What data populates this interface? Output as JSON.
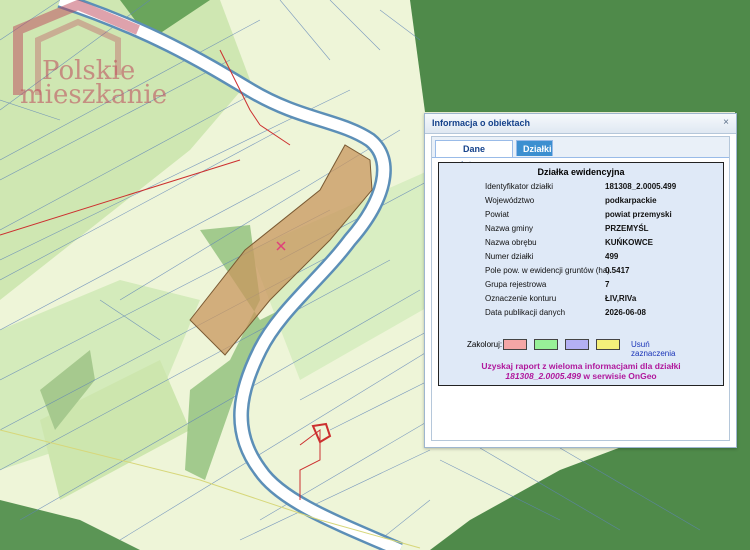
{
  "watermark": {
    "line1": "Polskie",
    "line2": "mieszkanie"
  },
  "panel": {
    "title": "Informacja o obiektach",
    "close": "×",
    "tabs": {
      "basic": "Dane podstawowe",
      "plots": "Działki"
    },
    "section_title": "Działka ewidencyjna",
    "attributes": [
      {
        "label": "Identyfikator działki",
        "value": "181308_2.0005.499"
      },
      {
        "label": "Województwo",
        "value": "podkarpackie"
      },
      {
        "label": "Powiat",
        "value": "powiat przemyski"
      },
      {
        "label": "Nazwa gminy",
        "value": "PRZEMYŚL"
      },
      {
        "label": "Nazwa obrębu",
        "value": "KUŃKOWCE"
      },
      {
        "label": "Numer działki",
        "value": "499"
      },
      {
        "label": "Pole pow. w ewidencji gruntów (ha)",
        "value": "0.5417"
      },
      {
        "label": "Grupa rejestrowa",
        "value": "7"
      },
      {
        "label": "Oznaczenie konturu",
        "value": "ŁIV,RIVa"
      },
      {
        "label": "Data publikacji danych",
        "value": "2026-06-08"
      }
    ],
    "colorize_label": "Zakoloruj:",
    "clear_selection": "Usuń zaznaczenia",
    "report_prefix": "Uzyskaj raport z wieloma informacjami dla działki",
    "report_parcel": "181308_2.0005.499",
    "report_suffix": "w serwisie OnGeo"
  },
  "colors": {
    "forest": "#3f7d3f",
    "road": "#ffffff",
    "parcel": "#c8955e",
    "marker": "#e0407a"
  }
}
